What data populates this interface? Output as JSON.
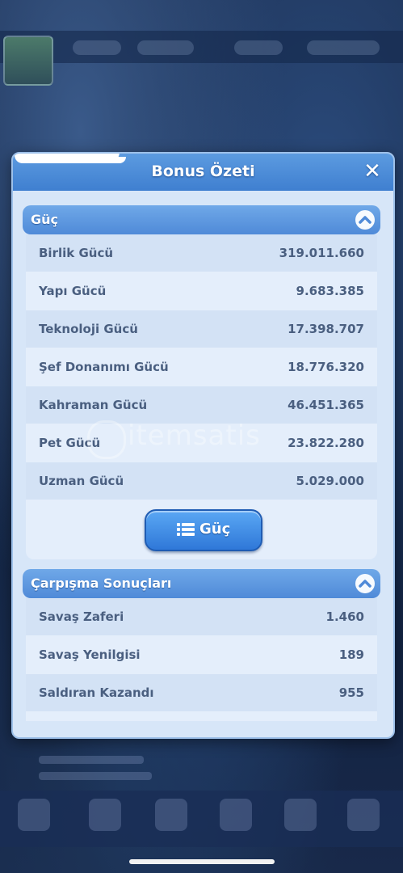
{
  "dialog": {
    "title": "Bonus Özeti",
    "close_symbol": "✕"
  },
  "power_section": {
    "title": "Güç",
    "rows": [
      {
        "label": "Birlik Gücü",
        "value": "319.011.660"
      },
      {
        "label": "Yapı Gücü",
        "value": "9.683.385"
      },
      {
        "label": "Teknoloji Gücü",
        "value": "17.398.707"
      },
      {
        "label": "Şef Donanımı Gücü",
        "value": "18.776.320"
      },
      {
        "label": "Kahraman Gücü",
        "value": "46.451.365"
      },
      {
        "label": "Pet Gücü",
        "value": "23.822.280"
      },
      {
        "label": "Uzman Gücü",
        "value": "5.029.000"
      }
    ],
    "button_label": "Güç",
    "button_icon": "list-icon"
  },
  "battle_section": {
    "title": "Çarpışma Sonuçları",
    "rows": [
      {
        "label": "Savaş Zaferi",
        "value": "1.460"
      },
      {
        "label": "Savaş Yenilgisi",
        "value": "189"
      },
      {
        "label": "Saldıran Kazandı",
        "value": "955"
      }
    ]
  },
  "watermark": "itemsatis",
  "colors": {
    "header": "#4f8ad8",
    "row_dark": "#d3e2f5",
    "row_light": "#e4eefb",
    "text": "#4a5f80",
    "button": "#2f78d8"
  }
}
